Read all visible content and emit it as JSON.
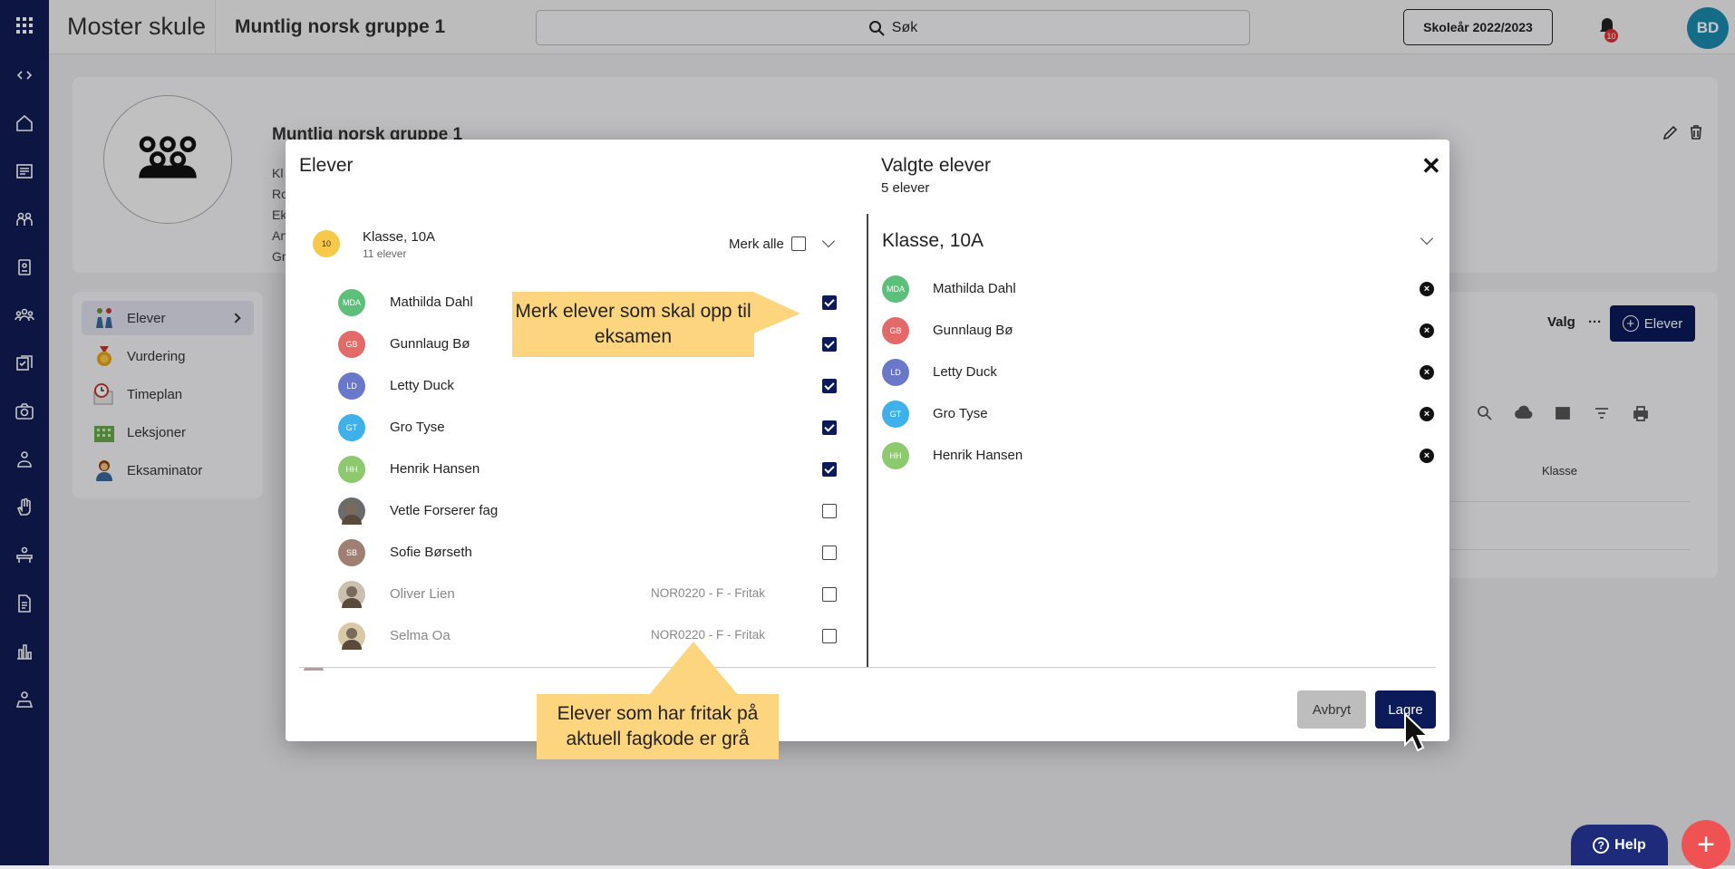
{
  "app": {
    "brand": "Moster skule",
    "group_title": "Muntlig norsk gruppe 1"
  },
  "search": {
    "label": "Søk"
  },
  "school_year": "Skoleår 2022/2023",
  "notifications": {
    "count": "10"
  },
  "user": {
    "initials": "BD"
  },
  "background": {
    "card_name": "Muntlig norsk gruppe 1",
    "card_lines": [
      "Kl",
      "Ro",
      "Ek",
      "An",
      "Gr"
    ],
    "side_menu": [
      {
        "label": "Elever",
        "icon": "students-icon"
      },
      {
        "label": "Vurdering",
        "icon": "medal-icon"
      },
      {
        "label": "Timeplan",
        "icon": "clock-icon"
      },
      {
        "label": "Leksjoner",
        "icon": "building-icon"
      },
      {
        "label": "Eksaminator",
        "icon": "examiner-icon"
      }
    ],
    "valg_label": "Valg",
    "elever_button": "Elever",
    "column_klasse": "Klasse"
  },
  "modal": {
    "left_title": "Elever",
    "right_title": "Valgte elever",
    "right_count": "5 elever",
    "class_badge": "10",
    "class_name": "Klasse, 10A",
    "class_count": "11 elever",
    "select_all": "Merk alle",
    "students": [
      {
        "initials": "MDA",
        "name": "Mathilda Dahl",
        "color": "#5cbf7a",
        "checked": true,
        "fritak": "",
        "grey": false,
        "photo": false
      },
      {
        "initials": "GB",
        "name": "Gunnlaug Bø",
        "color": "#e46a6a",
        "checked": true,
        "fritak": "",
        "grey": false,
        "photo": false
      },
      {
        "initials": "LD",
        "name": "Letty Duck",
        "color": "#6a78c9",
        "checked": true,
        "fritak": "",
        "grey": false,
        "photo": false
      },
      {
        "initials": "GT",
        "name": "Gro Tyse",
        "color": "#3fb1ea",
        "checked": true,
        "fritak": "",
        "grey": false,
        "photo": false
      },
      {
        "initials": "HH",
        "name": "Henrik Hansen",
        "color": "#8dc96e",
        "checked": true,
        "fritak": "",
        "grey": false,
        "photo": false
      },
      {
        "initials": "",
        "name": "Vetle Forserer fag",
        "color": "#6b6b6b",
        "checked": false,
        "fritak": "",
        "grey": false,
        "photo": true
      },
      {
        "initials": "SB",
        "name": "Sofie Børseth",
        "color": "#a07f73",
        "checked": false,
        "fritak": "",
        "grey": false,
        "photo": false
      },
      {
        "initials": "",
        "name": "Oliver Lien",
        "color": "#c9c0b0",
        "checked": false,
        "fritak": "NOR0220 - F - Fritak",
        "grey": true,
        "photo": true
      },
      {
        "initials": "",
        "name": "Selma Oa",
        "color": "#d9c9a8",
        "checked": false,
        "fritak": "NOR0220 - F - Fritak",
        "grey": true,
        "photo": true
      }
    ],
    "selected_class": "Klasse, 10A",
    "selected": [
      {
        "initials": "MDA",
        "name": "Mathilda Dahl",
        "color": "#5cbf7a"
      },
      {
        "initials": "GB",
        "name": "Gunnlaug Bø",
        "color": "#e46a6a"
      },
      {
        "initials": "LD",
        "name": "Letty Duck",
        "color": "#6a78c9"
      },
      {
        "initials": "GT",
        "name": "Gro Tyse",
        "color": "#3fb1ea"
      },
      {
        "initials": "HH",
        "name": "Henrik Hansen",
        "color": "#8dc96e"
      }
    ],
    "cancel_label": "Avbryt",
    "save_label": "Lagre"
  },
  "callouts": {
    "top": "Merk elever som skal opp til eksamen",
    "bottom": "Elever som har fritak på aktuell fagkode er grå"
  },
  "help_label": "Help",
  "colors": {
    "primary": "#0c1a5a",
    "sidebar": "#111d55",
    "callout": "#fdd57f",
    "fab": "#ee5253"
  }
}
